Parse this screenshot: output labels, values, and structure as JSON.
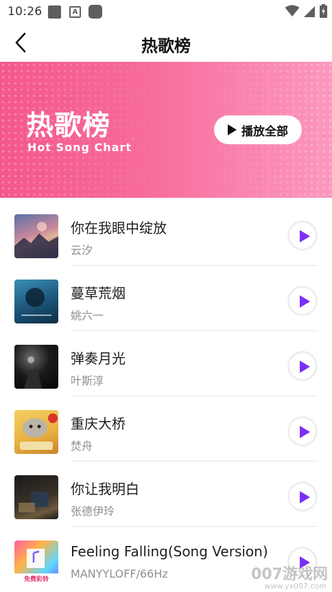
{
  "status_bar": {
    "time": "10:26",
    "a_icon_letter": "A"
  },
  "header": {
    "title": "热歌榜"
  },
  "banner": {
    "title": "热歌榜",
    "subtitle": "Hot Song Chart",
    "play_all_label": "播放全部"
  },
  "songs": [
    {
      "title": "你在我眼中绽放",
      "artist": "云汐"
    },
    {
      "title": "蔓草荒烟",
      "artist": "姚六一"
    },
    {
      "title": "弹奏月光",
      "artist": "叶斯淳"
    },
    {
      "title": "重庆大桥",
      "artist": "焚舟"
    },
    {
      "title": "你让我明白",
      "artist": "张德伊玲"
    },
    {
      "title": "Feeling Falling(Song Version)",
      "artist": "MANYYLOFF/66Hz",
      "cover_badge": "免费彩铃"
    }
  ],
  "watermark": {
    "text": "007游戏网",
    "url": "www.yx007.com"
  },
  "colors": {
    "accent_purple": "#7b2ff7",
    "banner_pink": "#f4578b"
  }
}
